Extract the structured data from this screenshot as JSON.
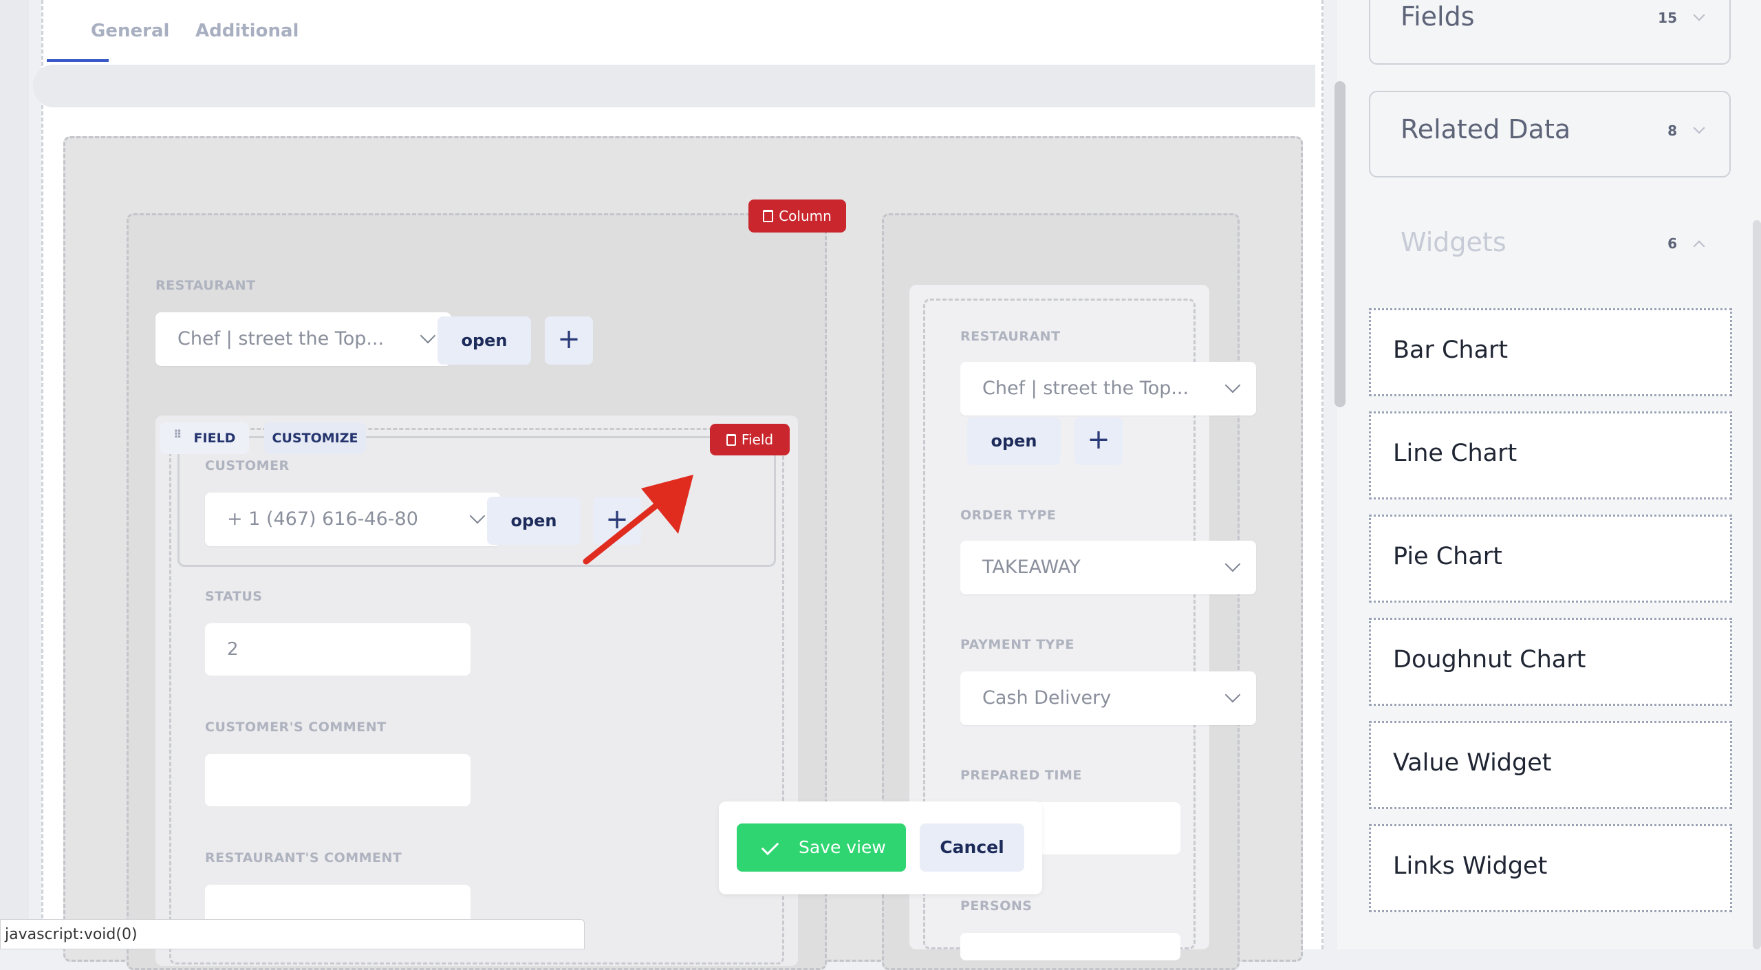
{
  "tabs": [
    {
      "label": "General"
    },
    {
      "label": "Additional"
    }
  ],
  "column_tag": "Column",
  "field_tag": "Field",
  "left_column": {
    "restaurant_label": "RESTAURANT",
    "restaurant_value": "Chef | street the Top...",
    "open_label": "open",
    "plus_label": "+",
    "field_pill": "FIELD",
    "customize_pill": "CUSTOMIZE",
    "customer_label": "CUSTOMER",
    "customer_value": "+ 1 (467) 616-46-80",
    "customer_open": "open",
    "status_label": "STATUS",
    "status_value": "2",
    "customer_comment_label": "CUSTOMER'S COMMENT",
    "restaurant_comment_label": "RESTAURANT'S COMMENT"
  },
  "right_column": {
    "restaurant_label": "RESTAURANT",
    "restaurant_value": "Chef | street the Top...",
    "open_label": "open",
    "order_type_label": "ORDER TYPE",
    "order_type_value": "TAKEAWAY",
    "payment_type_label": "PAYMENT TYPE",
    "payment_type_value": "Cash Delivery",
    "prepared_time_label": "PREPARED TIME",
    "persons_label": "PERSONS"
  },
  "save_bar": {
    "save_label": "Save view",
    "cancel_label": "Cancel"
  },
  "sidebar": {
    "sections": [
      {
        "title": "Fields",
        "count": "15"
      },
      {
        "title": "Related Data",
        "count": "8"
      },
      {
        "title": "Widgets",
        "count": "6"
      }
    ],
    "widgets": [
      {
        "label": "Bar Chart"
      },
      {
        "label": "Line Chart"
      },
      {
        "label": "Pie Chart"
      },
      {
        "label": "Doughnut Chart"
      },
      {
        "label": "Value Widget"
      },
      {
        "label": "Links Widget"
      }
    ]
  },
  "status_url": "javascript:void(0)",
  "colors": {
    "danger": "#c9272d",
    "success": "#2fd571",
    "accent": "#3a5bc7",
    "annotation_arrow": "#e02b1f"
  }
}
